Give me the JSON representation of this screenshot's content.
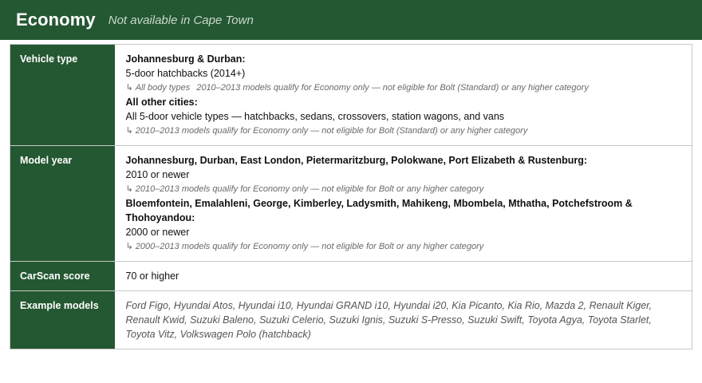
{
  "header": {
    "title": "Economy",
    "subtitle": "Not available in Cape Town"
  },
  "rows": {
    "vehicle_type": {
      "label": "Vehicle type",
      "group1_heading": "Johannesburg & Durban:",
      "group1_value": "5-door hatchbacks (2014+)",
      "group1_note_prefix": "All body types",
      "group1_note": "2010–2013 models qualify for Economy only — not eligible for Bolt (Standard) or any higher category",
      "group2_heading": "All other cities:",
      "group2_value": "All 5-door vehicle types — hatchbacks, sedans, crossovers, station wagons, and vans",
      "group2_note": "2010–2013 models qualify for Economy only — not eligible for Bolt (Standard) or any higher category"
    },
    "model_year": {
      "label": "Model year",
      "group1_heading": "Johannesburg, Durban, East London, Pietermaritzburg, Polokwane, Port Elizabeth & Rustenburg:",
      "group1_value": "2010 or newer",
      "group1_note": "2010–2013 models qualify for Economy only — not eligible for Bolt or any higher category",
      "group2_heading": "Bloemfontein, Emalahleni, George, Kimberley, Ladysmith, Mahikeng, Mbombela, Mthatha, Potchefstroom & Thohoyandou:",
      "group2_value": "2000 or newer",
      "group2_note": "2000–2013 models qualify for Economy only — not eligible for Bolt or any higher category"
    },
    "carscan": {
      "label": "CarScan score",
      "value": "70 or higher"
    },
    "example_models": {
      "label": "Example models",
      "value": "Ford Figo, Hyundai Atos, Hyundai i10, Hyundai GRAND i10, Hyundai i20, Kia Picanto, Kia Rio, Mazda 2, Renault Kiger, Renault Kwid, Suzuki Baleno, Suzuki Celerio, Suzuki Ignis, Suzuki S-Presso, Suzuki Swift, Toyota Agya, Toyota Starlet, Toyota Vitz, Volkswagen Polo (hatchback)"
    }
  },
  "icons": {
    "note_arrow": "return-arrow-icon"
  },
  "colors": {
    "header_bg": "#245832",
    "label_bg": "#245832"
  }
}
